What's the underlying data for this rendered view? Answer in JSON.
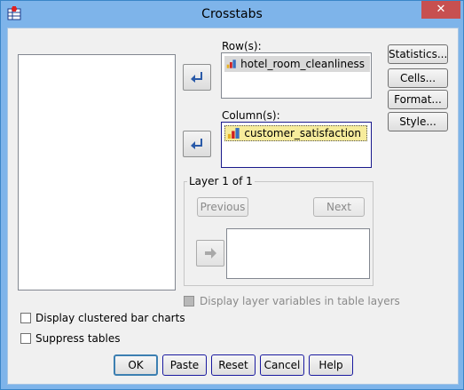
{
  "window": {
    "title": "Crosstabs",
    "close_glyph": "✕"
  },
  "rows": {
    "label": "Row(s):",
    "item": "hotel_room_cleanliness"
  },
  "columns": {
    "label": "Column(s):",
    "item": "customer_satisfaction"
  },
  "layer": {
    "title": "Layer 1 of 1",
    "previous": "Previous",
    "next": "Next"
  },
  "side_buttons": {
    "statistics": "Statistics...",
    "cells": "Cells...",
    "format": "Format...",
    "style": "Style..."
  },
  "options": {
    "display_layer": "Display layer variables in table layers",
    "clustered_bar": "Display clustered bar charts",
    "suppress_tables": "Suppress tables"
  },
  "bottom_buttons": {
    "ok": "OK",
    "paste": "Paste",
    "reset": "Reset",
    "cancel": "Cancel",
    "help": "Help"
  },
  "colors": {
    "title_bar": "#7eb4ea",
    "close_button": "#c75050",
    "selected_yellow": "#f7ec9c",
    "dialog_bg": "#f0f0f0"
  },
  "icons": [
    "app-icon",
    "close-icon",
    "move-arrow-icon",
    "nominal-variable-icon"
  ]
}
